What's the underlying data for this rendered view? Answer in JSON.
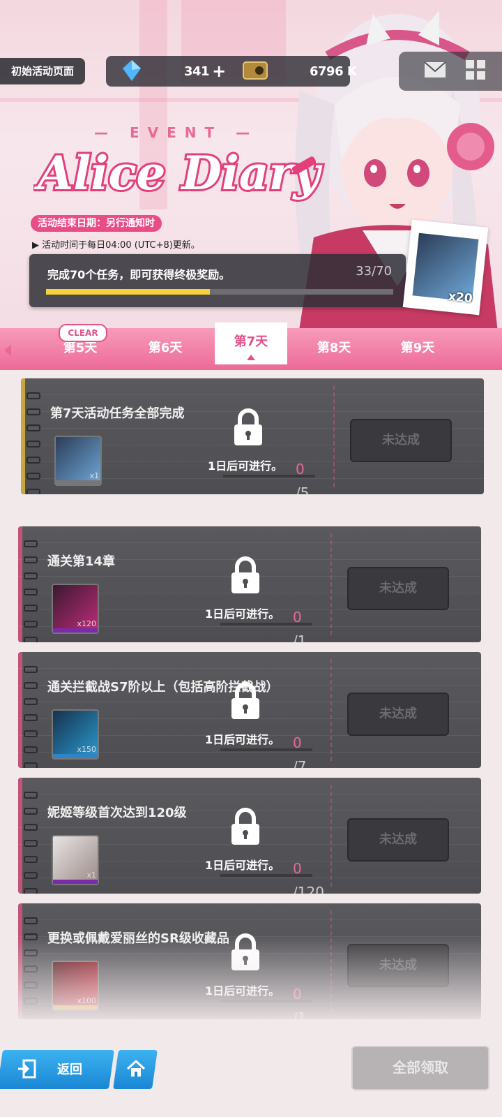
{
  "header": {
    "page_name": "初始活动页面",
    "gems": "341",
    "credits": "6796 K",
    "event_word": "— EVENT —",
    "logo_text": "Alice Diary",
    "end_date": "活动结束日期：另行通知时",
    "refresh_note": "▶ 活动时间于每日04:00 (UTC+8)更新。"
  },
  "progress": {
    "message": "完成70个任务，即可获得终极奖励。",
    "count": "33/70",
    "current": 33,
    "total": 70,
    "reward_qty": "x20"
  },
  "tabs": {
    "clear_badge": "CLEAR",
    "items": [
      "第5天",
      "第6天",
      "第7天",
      "第8天",
      "第9天"
    ],
    "active_index": 2
  },
  "lock_text": "1日后可进行。",
  "button_unachieved": "未达成",
  "missions": [
    {
      "title": "第7天活动任务全部完成",
      "cur": "0",
      "total": "/5",
      "qty": "x1"
    },
    {
      "title": "通关第14章",
      "cur": "0",
      "total": "/1",
      "qty": "x120"
    },
    {
      "title": "通关拦截战S7阶以上（包括高阶拦截战）",
      "cur": "0",
      "total": "/7",
      "qty": "x150"
    },
    {
      "title": "妮姬等级首次达到120级",
      "cur": "0",
      "total": "/120",
      "qty": "x1"
    },
    {
      "title": "更换或佩戴爱丽丝的SR级收藏品",
      "cur": "0",
      "total": "/1",
      "qty": "x100"
    }
  ],
  "footer": {
    "back": "返回",
    "claim_all": "全部领取"
  },
  "colors": {
    "accent_pink": "#e4508a",
    "progress_yellow": "#f7d33b",
    "nav_blue": "#1a86d4"
  }
}
